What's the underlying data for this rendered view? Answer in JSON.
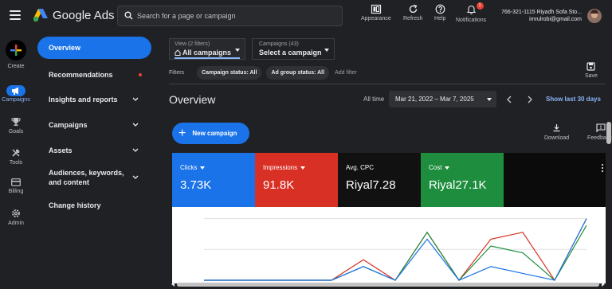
{
  "brand": "Google Ads",
  "search": {
    "placeholder": "Search for a page or campaign"
  },
  "toolbar": {
    "appearance": "Appearance",
    "refresh": "Refresh",
    "help": "Help",
    "notifications": "Notifications",
    "notification_count": "1"
  },
  "account": {
    "line1": "766-321-1115 Riyadh Sofa Sto...",
    "line2": "imrulrobi@gmail.com"
  },
  "rail": {
    "create": "Create",
    "campaigns": "Campaigns",
    "goals": "Goals",
    "tools": "Tools",
    "billing": "Billing",
    "admin": "Admin"
  },
  "nav": {
    "items": [
      {
        "label": "Overview"
      },
      {
        "label": "Recommendations"
      },
      {
        "label": "Insights and reports"
      },
      {
        "label": "Campaigns"
      },
      {
        "label": "Assets"
      },
      {
        "label": "Audiences, keywords, and content"
      },
      {
        "label": "Change history"
      }
    ]
  },
  "selectors": {
    "view_label": "View (2 filters)",
    "view_value": "All campaigns",
    "campaigns_label": "Campaigns (43)",
    "campaigns_value": "Select a campaign"
  },
  "filters": {
    "label": "Filters",
    "chip1": "Campaign status: All",
    "chip2": "Ad group status: All",
    "add": "Add filter"
  },
  "save": "Save",
  "page_title": "Overview",
  "date": {
    "all_time": "All time",
    "range": "Mar 21, 2022 – Mar 7, 2025",
    "show_last": "Show last 30 days"
  },
  "new_campaign": "New campaign",
  "download": "Download",
  "feedback": "Feedback",
  "scorecards": [
    {
      "label": "Clicks",
      "value": "3.73K"
    },
    {
      "label": "Impressions",
      "value": "91.8K"
    },
    {
      "label": "Avg. CPC",
      "value": "Riyal7.28"
    },
    {
      "label": "Cost",
      "value": "Riyal27.1K"
    }
  ],
  "colors": {
    "clicks": "#1a73e8",
    "impressions": "#d93025",
    "cost": "#1e8e3e"
  },
  "chart_data": {
    "type": "line",
    "x": [
      0,
      1,
      2,
      3,
      4,
      5,
      6,
      7,
      8,
      9,
      10,
      11,
      12
    ],
    "series": [
      {
        "values": [
          0,
          0,
          0,
          0,
          0,
          2,
          0,
          6,
          0,
          2,
          1,
          0,
          9
        ]
      },
      {
        "values": [
          0,
          0,
          0,
          0,
          0,
          3,
          0,
          7,
          0,
          6,
          7,
          0,
          9
        ]
      },
      {
        "values": [
          0,
          0,
          0,
          0,
          0,
          2,
          0,
          7,
          0,
          5,
          4,
          0,
          8
        ]
      }
    ],
    "ylim": [
      0,
      10
    ],
    "grid": true
  }
}
